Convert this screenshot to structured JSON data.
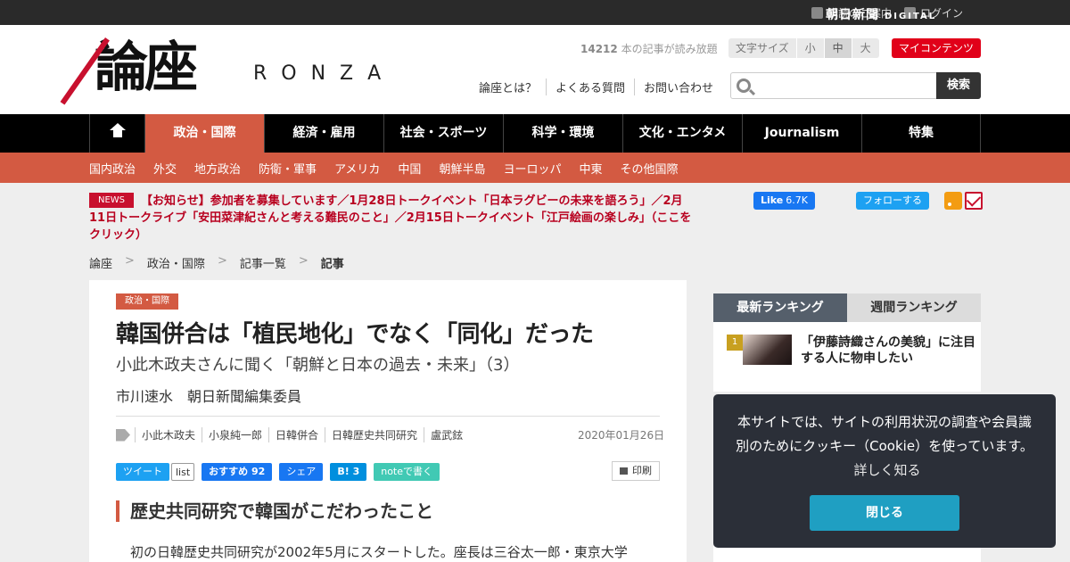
{
  "topbar": {
    "links": [
      {
        "label": "購読のご案内",
        "icon": "pencil-icon"
      },
      {
        "label": "ログイン",
        "icon": "lock-icon"
      }
    ],
    "brand": "朝日新聞",
    "brand_sub": "DIGITAL"
  },
  "header": {
    "logo_kanji": "論座",
    "logo_latin": "RONZA",
    "counter_number": "14212",
    "counter_text": " 本の記事が読み放題",
    "font_size_label": "文字サイズ",
    "font_size_options": [
      "小",
      "中",
      "大"
    ],
    "font_size_selected": "中",
    "my_contents": "マイコンテンツ",
    "help_links": [
      "論座とは？",
      "よくある質問",
      "お問い合わせ"
    ],
    "search_placeholder": "",
    "search_button": "検索"
  },
  "main_nav": [
    "政治・国際",
    "経済・雇用",
    "社会・スポーツ",
    "科学・環境",
    "文化・エンタメ",
    "Journalism",
    "特集"
  ],
  "main_nav_active": "政治・国際",
  "sub_nav": [
    "国内政治",
    "外交",
    "地方政治",
    "防衛・軍事",
    "アメリカ",
    "中国",
    "朝鮮半島",
    "ヨーロッパ",
    "中東",
    "その他国際"
  ],
  "news": {
    "badge": "NEWS",
    "text": "【お知らせ】参加者を募集しています／1月28日トークイベント「日本ラグビーの未来を語ろう」／2月11日トークライブ「安田菜津紀さんと考える難民のこと」／2月15日トークイベント「江戸絵画の楽しみ」（ここをクリック）"
  },
  "social": {
    "fb_like": "Like",
    "fb_like_count": "6.7K",
    "twitter_follow": "フォローする"
  },
  "breadcrumb": [
    "論座",
    "政治・国際",
    "記事一覧",
    "記事"
  ],
  "breadcrumb_sep": ">",
  "article": {
    "category": "政治・国際",
    "title": "韓国併合は「植民地化」でなく「同化」だった",
    "subtitle": "小此木政夫さんに聞く「朝鮮と日本の過去・未来」（3）",
    "author": "市川速水　朝日新聞編集委員",
    "tags": [
      "小此木政夫",
      "小泉純一郎",
      "日韓併合",
      "日韓歴史共同研究",
      "盧武鉉"
    ],
    "date": "2020年01月26日",
    "share": {
      "tweet": "ツイート",
      "list": "list",
      "fb_recommend": "おすすめ",
      "fb_count": "92",
      "fb_share": "シェア",
      "hatena": "B!",
      "hatena_count": "3",
      "note": "noteで書く",
      "print": "印刷"
    },
    "heading": "歴史共同研究で韓国がこだわったこと",
    "paragraph": "初の日韓歴史共同研究が2002年5月にスタートした。座長は三谷太一郎・東京大学"
  },
  "ranking": {
    "tabs": [
      "最新ランキング",
      "週間ランキング"
    ],
    "active_tab": "最新ランキング",
    "items": [
      {
        "rank": "1",
        "title": "「伊藤詩織さんの美貌」に注目する人に物申したい"
      }
    ]
  },
  "cookie": {
    "text": "本サイトでは、サイトの利用状況の調査や会員識別のためにクッキー（Cookie）を使っています。",
    "more": "詳しく知る",
    "close": "閉じる"
  }
}
